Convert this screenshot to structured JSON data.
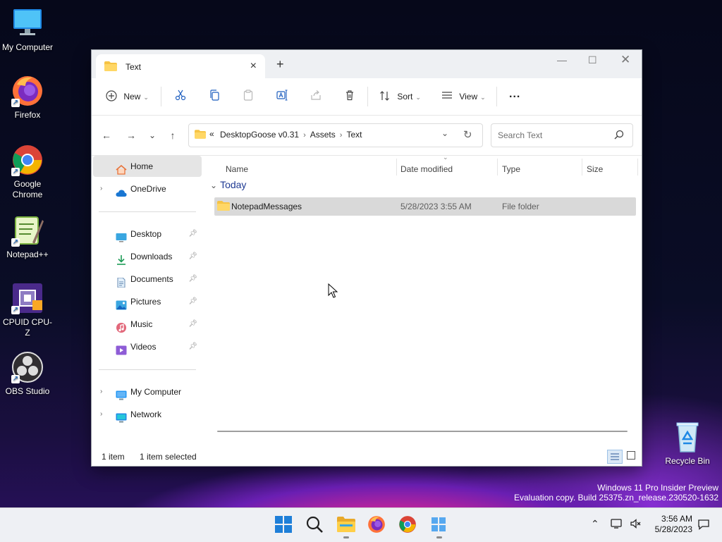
{
  "desktop": {
    "icons": [
      {
        "label": "My Computer"
      },
      {
        "label": "Firefox"
      },
      {
        "label": "Google Chrome"
      },
      {
        "label": "Notepad++"
      },
      {
        "label": "CPUID CPU-Z"
      },
      {
        "label": "OBS Studio"
      },
      {
        "label": "Recycle Bin"
      }
    ],
    "watermark": {
      "line1": "Windows 11 Pro Insider Preview",
      "line2": "Evaluation copy. Build 25375.zn_release.230520-1632"
    }
  },
  "window": {
    "tab_title": "Text",
    "toolbar": {
      "new_label": "New",
      "sort_label": "Sort",
      "view_label": "View",
      "more_label": "..."
    },
    "address": {
      "overflow": "«",
      "crumbs": [
        "DesktopGoose v0.31",
        "Assets",
        "Text"
      ],
      "search_placeholder": "Search Text"
    },
    "sidebar": {
      "home": "Home",
      "onedrive": "OneDrive",
      "quick_access": [
        "Desktop",
        "Downloads",
        "Documents",
        "Pictures",
        "Music",
        "Videos"
      ],
      "my_computer": "My Computer",
      "network": "Network"
    },
    "columns": {
      "name": "Name",
      "date": "Date modified",
      "type": "Type",
      "size": "Size"
    },
    "group_label": "Today",
    "files": [
      {
        "name": "NotepadMessages",
        "date": "5/28/2023 3:55 AM",
        "type": "File folder",
        "size": ""
      }
    ],
    "status": {
      "count": "1 item",
      "selected": "1 item selected"
    }
  },
  "taskbar": {
    "time": "3:56 AM",
    "date": "5/28/2023"
  }
}
